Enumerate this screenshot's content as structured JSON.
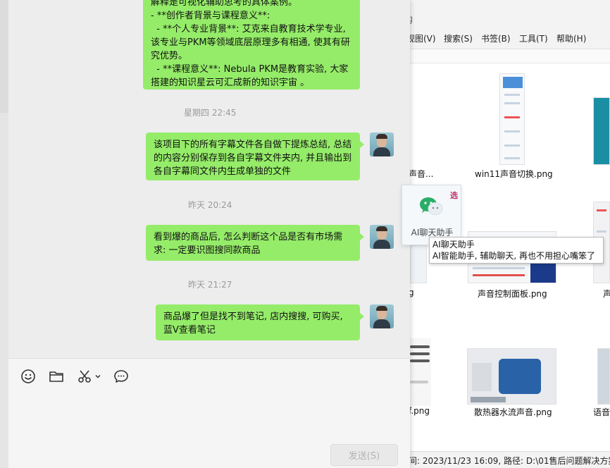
{
  "explorer": {
    "title_fragment": "g",
    "menus": [
      "视图(V)",
      "搜索(S)",
      "书签(B)",
      "工具(T)",
      "帮助(H)"
    ],
    "menu_first_fragment": "视图(V)",
    "files": {
      "left_col_top": "声音...",
      "win11": "win11声音切换.png",
      "left_col_mid": "g",
      "sound_panel": "声音控制面板.png",
      "right_col_mid": "声",
      "left_col_bottom": "f.png",
      "cooler": "散热器水流声音.png",
      "right_col_bottom": "语音"
    },
    "status": "间: 2023/11/23 16:09, 路径: D:\\01售后问题解决方案"
  },
  "chat": {
    "messages": [
      {
        "text": "解释是可视化辅助思考的具体案例。\n- **创作者背景与课程意义**:\n  - **个人专业背景**: 艾克来自教育技术学专业, 该专业与PKM等领域底层原理多有相通, 使其有研究优势。\n  - **课程意义**: Nebula PKM是教育实验, 大家搭建的知识星云可汇成新的知识宇宙 。"
      },
      {
        "time": "星期四 22:45",
        "text": "该项目下的所有字幕文件各自做下提炼总结, 总结的内容分别保存到各自字幕文件夹内, 并且输出到各自字幕同文件内生成单独的文件"
      },
      {
        "time": "昨天 20:24",
        "text": "看到爆的商品后, 怎么判断这个品是否有市场需求: 一定要识图搜同款商品"
      },
      {
        "time": "昨天 21:27",
        "text": "商品爆了但是找不到笔记, 店内搜搜, 可购买, 蓝V查看笔记"
      }
    ],
    "toolbar": {
      "emoji": "smiley-icon",
      "file": "folder-icon",
      "screenshot": "scissors-icon",
      "chat_history": "chat-bubble-icon"
    },
    "send_label": "发送(S)"
  },
  "popup": {
    "app_name": "AI聊天助手",
    "badge": "选",
    "tooltip_title": "AI聊天助手",
    "tooltip_desc": "AI智能助手, 辅助聊天, 再也不用担心嘴笨了"
  },
  "colors": {
    "bubble": "#95ec69",
    "chat_bg": "#ededed",
    "wechat_green": "#2aae67"
  }
}
